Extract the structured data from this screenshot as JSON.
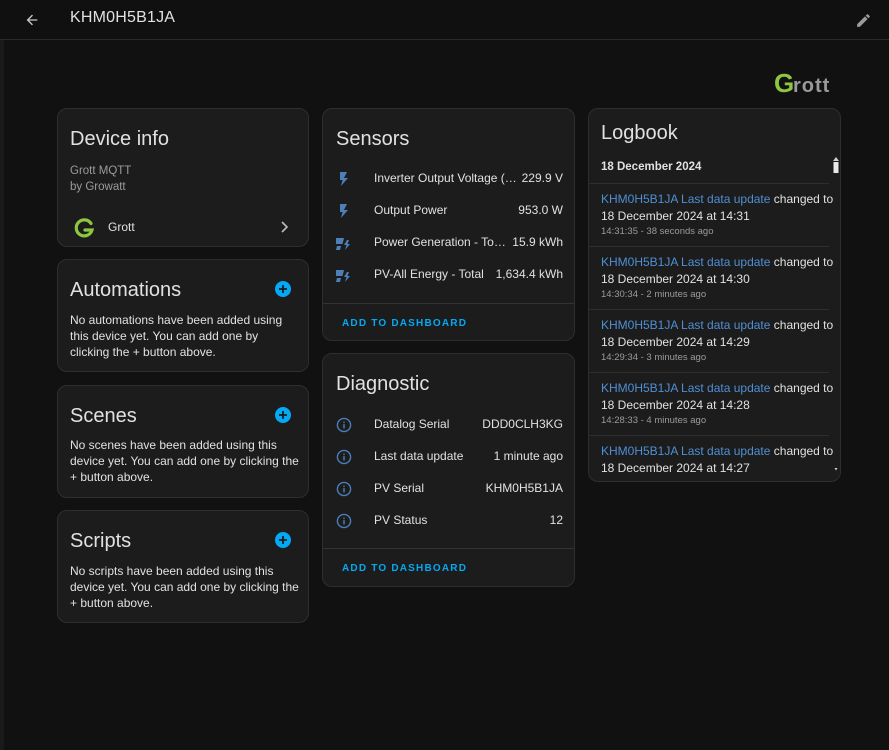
{
  "header": {
    "title": "KHM0H5B1JA"
  },
  "brand": {
    "logo_text": "Grott",
    "accent": "#8dc63f"
  },
  "colors": {
    "accent": "#03a9f4",
    "link": "#4f8fd4",
    "card_bg": "#1c1c1c",
    "page_bg": "#111111"
  },
  "device_info": {
    "title": "Device info",
    "model": "Grott MQTT",
    "manufacturer": "by Growatt",
    "integration": "Grott"
  },
  "automations": {
    "title": "Automations",
    "empty_text": "No automations have been added using this device yet. You can add one by clicking the + button above."
  },
  "scenes": {
    "title": "Scenes",
    "empty_text": "No scenes have been added using this device yet. You can add one by clicking the + button above."
  },
  "scripts": {
    "title": "Scripts",
    "empty_text": "No scripts have been added using this device yet. You can add one by clicking the + button above."
  },
  "sensors": {
    "title": "Sensors",
    "rows": [
      {
        "icon": "flash-icon",
        "label": "Inverter Output Voltage (Si...",
        "value": "229.9 V"
      },
      {
        "icon": "flash-icon",
        "label": "Output Power",
        "value": "953.0 W"
      },
      {
        "icon": "solar-power-icon",
        "label": "Power Generation - Toda...",
        "value": "15.9 kWh"
      },
      {
        "icon": "solar-power-icon",
        "label": "PV-All Energy - Total",
        "value": "1,634.4 kWh"
      }
    ],
    "action": "ADD TO DASHBOARD"
  },
  "diagnostic": {
    "title": "Diagnostic",
    "rows": [
      {
        "icon": "info-icon",
        "label": "Datalog Serial",
        "value": "DDD0CLH3KG"
      },
      {
        "icon": "info-icon",
        "label": "Last data update",
        "value": "1 minute ago"
      },
      {
        "icon": "info-icon",
        "label": "PV Serial",
        "value": "KHM0H5B1JA"
      },
      {
        "icon": "info-icon",
        "label": "PV Status",
        "value": "12"
      }
    ],
    "action": "ADD TO DASHBOARD"
  },
  "logbook": {
    "title": "Logbook",
    "date_header": "18 December 2024",
    "entries": [
      {
        "link": "KHM0H5B1JA Last data update",
        "changed": "changed to",
        "value": "18 December 2024 at 14:31",
        "time": "14:31:35 - 38 seconds ago"
      },
      {
        "link": "KHM0H5B1JA Last data update",
        "changed": "changed to",
        "value": "18 December 2024 at 14:30",
        "time": "14:30:34 - 2 minutes ago"
      },
      {
        "link": "KHM0H5B1JA Last data update",
        "changed": "changed to",
        "value": "18 December 2024 at 14:29",
        "time": "14:29:34 - 3 minutes ago"
      },
      {
        "link": "KHM0H5B1JA Last data update",
        "changed": "changed to",
        "value": "18 December 2024 at 14:28",
        "time": "14:28:33 - 4 minutes ago"
      },
      {
        "link": "KHM0H5B1JA Last data update",
        "changed": "changed to",
        "value": "18 December 2024 at 14:27",
        "time": ""
      }
    ]
  }
}
